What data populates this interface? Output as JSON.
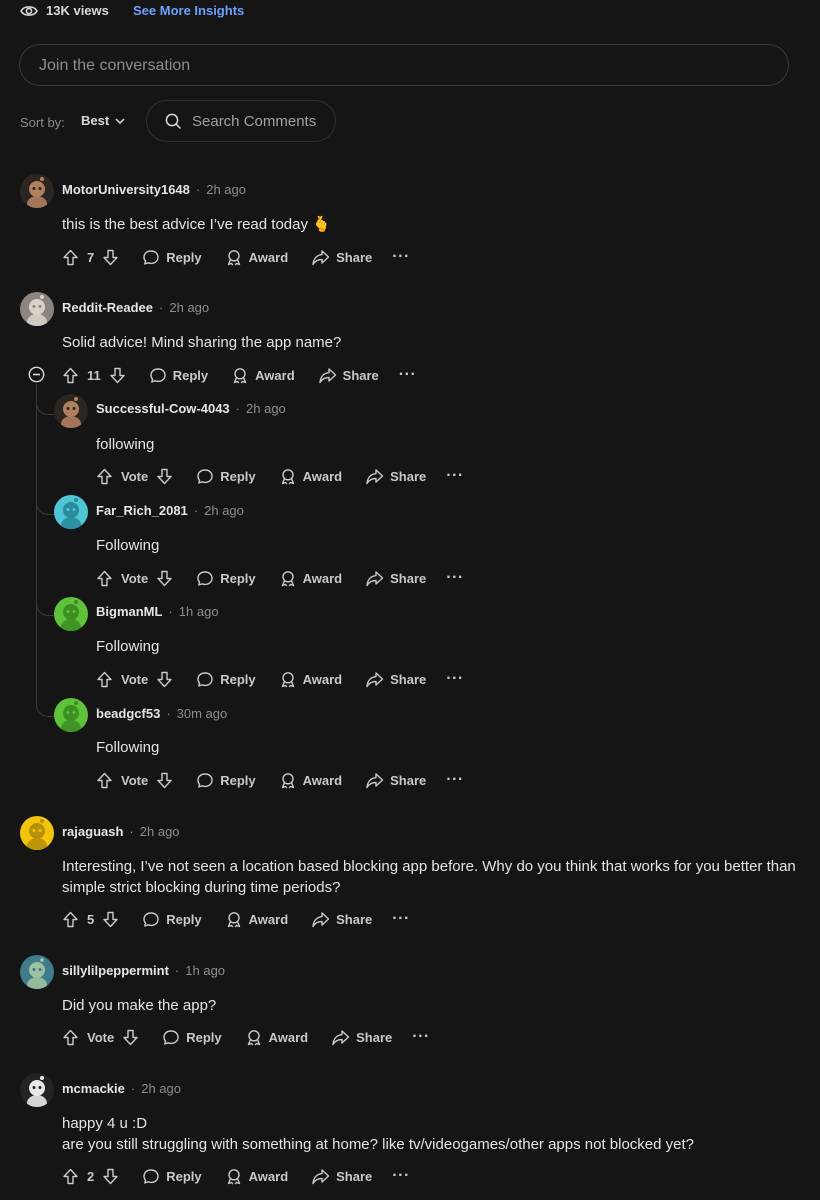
{
  "header": {
    "views": "13K views",
    "insights_link": "See More Insights"
  },
  "composer": {
    "placeholder": "Join the conversation"
  },
  "sort": {
    "label": "Sort by:",
    "value": "Best"
  },
  "search": {
    "placeholder": "Search Comments"
  },
  "actions": {
    "reply": "Reply",
    "award": "Award",
    "share": "Share",
    "more": "···",
    "vote": "Vote"
  },
  "colors": {
    "background": "#151515",
    "link": "#6ea0ff",
    "muted": "#8b8e90",
    "text": "#e3e5e7"
  },
  "comments": [
    {
      "user": "MotorUniversity1648",
      "time": "2h ago",
      "text": "this is the best advice I’ve read today 🫰",
      "votes": "7",
      "avatar": "snoo-avatar-brown"
    },
    {
      "user": "Reddit-Readee",
      "time": "2h ago",
      "text": "Solid advice! Mind sharing the app name?",
      "votes": "11",
      "avatar": "snoo-avatar-gray"
    },
    {
      "user": "Successful-Cow-4043",
      "time": "2h ago",
      "text": "following",
      "votes": "Vote",
      "avatar": "snoo-avatar-brown"
    },
    {
      "user": "Far_Rich_2081",
      "time": "2h ago",
      "text": "Following",
      "votes": "Vote",
      "avatar": "snoo-avatar-cyan"
    },
    {
      "user": "BigmanML",
      "time": "1h ago",
      "text": "Following",
      "votes": "Vote",
      "avatar": "snoo-avatar-green"
    },
    {
      "user": "beadgcf53",
      "time": "30m ago",
      "text": "Following",
      "votes": "Vote",
      "avatar": "snoo-avatar-green"
    },
    {
      "user": "rajaguash",
      "time": "2h ago",
      "text": "Interesting, I’ve not seen a location based blocking app before. Why do you think that works for you better than simple strict blocking during time periods?",
      "votes": "5",
      "avatar": "snoo-avatar-yellow"
    },
    {
      "user": "sillylilpeppermint",
      "time": "1h ago",
      "text": "Did you make the app?",
      "votes": "Vote",
      "avatar": "snoo-avatar-teal"
    },
    {
      "user": "mcmackie",
      "time": "2h ago",
      "text": "happy 4 u :D\nare you still struggling with something at home? like tv/videogames/other apps not blocked yet?",
      "votes": "2",
      "avatar": "snoo-avatar-white"
    }
  ]
}
